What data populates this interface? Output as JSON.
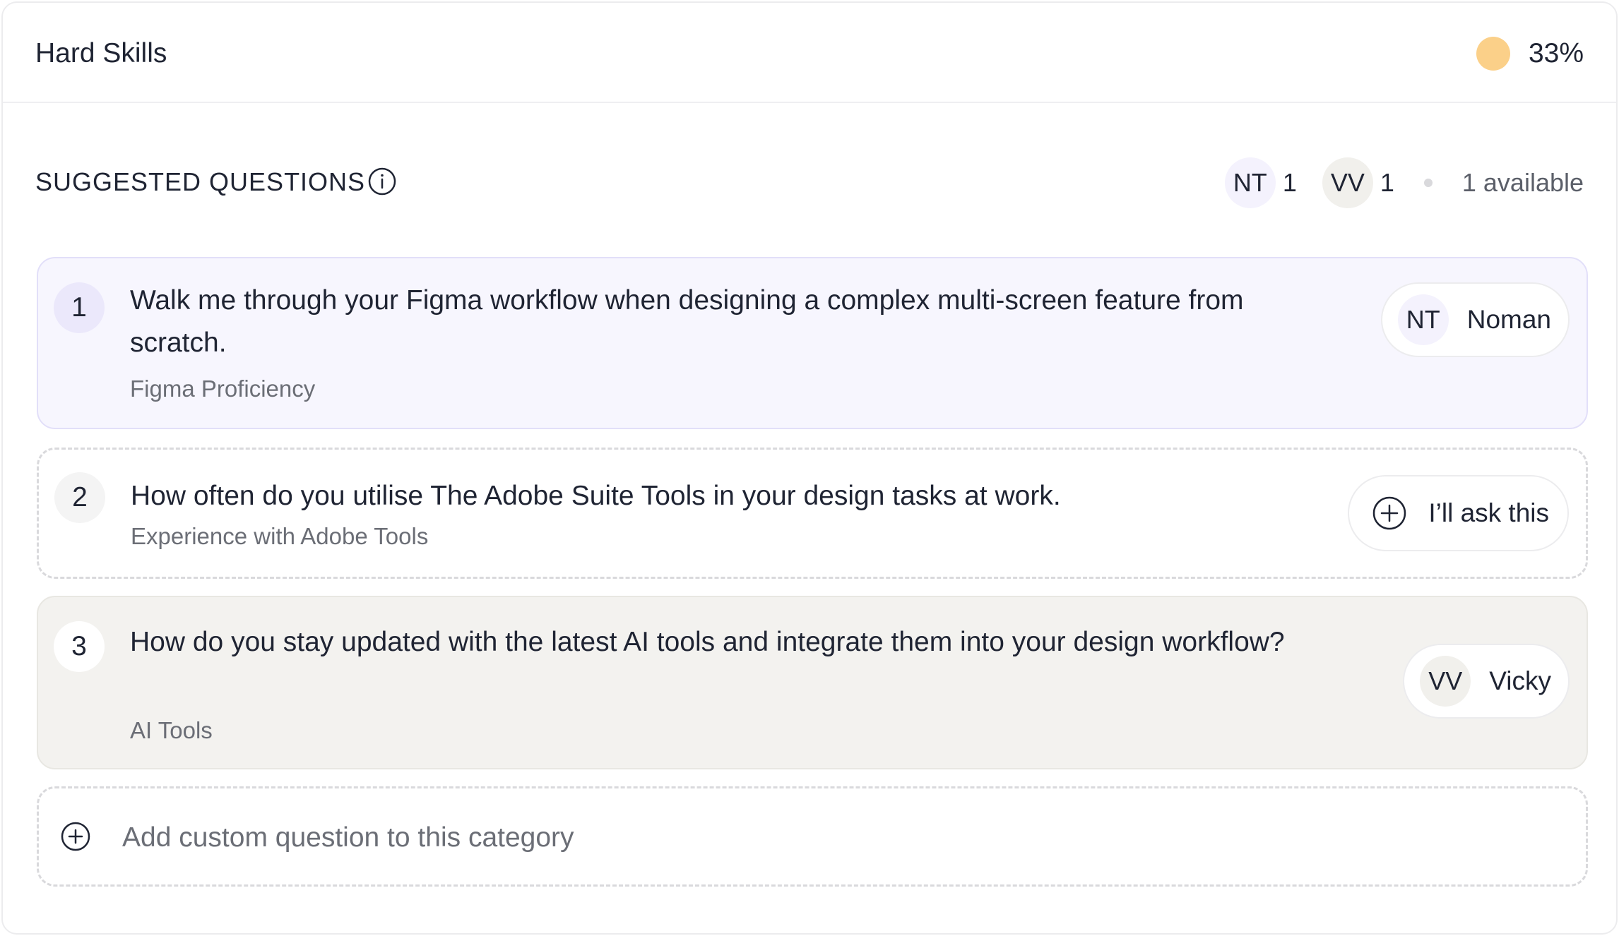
{
  "header": {
    "title": "Hard Skills",
    "progress": "33%",
    "progress_color": "#fbd089"
  },
  "section": {
    "title": "SUGGESTED QUESTIONS",
    "stats": [
      {
        "initials": "NT",
        "count": "1"
      },
      {
        "initials": "VV",
        "count": "1"
      }
    ],
    "available": "1 available"
  },
  "questions": [
    {
      "number": "1",
      "text": "Walk me through your Figma workflow when designing a complex multi-screen feature from scratch.",
      "category": "Figma Proficiency",
      "assignee": {
        "initials": "NT",
        "name": "Noman"
      }
    },
    {
      "number": "2",
      "text": "How often do you utilise The Adobe Suite Tools in your design tasks at work.",
      "category": "Experience with Adobe Tools",
      "action_label": "I’ll ask this"
    },
    {
      "number": "3",
      "text": "How do you stay updated with the latest AI tools and integrate them into your design workflow?",
      "category": "AI Tools",
      "assignee": {
        "initials": "VV",
        "name": "Vicky"
      }
    }
  ],
  "add_custom": {
    "label": "Add custom question to this category"
  }
}
